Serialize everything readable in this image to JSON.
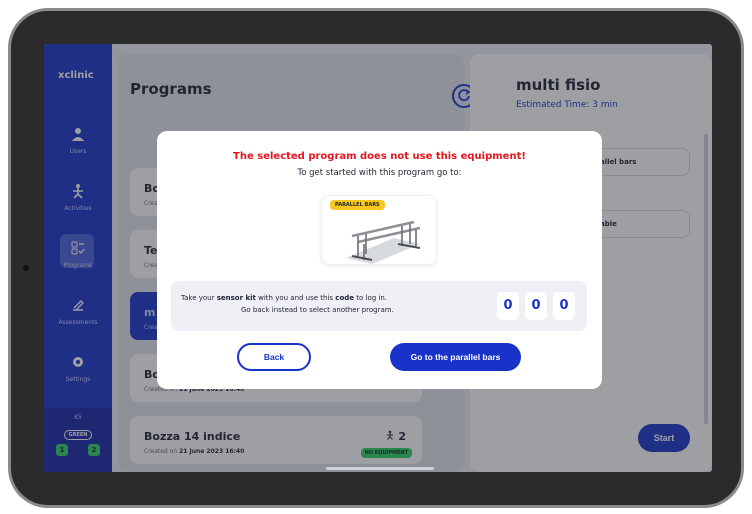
{
  "sidebar": {
    "brand": "xclinic",
    "items": [
      {
        "label": "Users",
        "icon": "user-icon"
      },
      {
        "label": "Activities",
        "icon": "activities-icon"
      },
      {
        "label": "Programs",
        "icon": "programs-icon"
      },
      {
        "label": "Assessments",
        "icon": "assessments-icon"
      },
      {
        "label": "Settings",
        "icon": "settings-icon"
      }
    ],
    "kit": {
      "id": "K5",
      "status": "GREEN",
      "left": "1",
      "right": "2"
    }
  },
  "programs": {
    "title": "Programs",
    "cards": [
      {
        "name": "Bo",
        "date_prefix": "Crea",
        "date": ""
      },
      {
        "name": "Te",
        "date_prefix": "Crea",
        "date": ""
      },
      {
        "name": "m",
        "date_prefix": "Crea",
        "date": ""
      },
      {
        "name": "Bo",
        "date_prefix": "Created on",
        "date": "21 June 2023 16:40"
      },
      {
        "name": "Bozza 14 indice",
        "date_prefix": "Created on",
        "date": "21 June 2023 16:40",
        "count": "2",
        "badge": "NO EQUIPMENT"
      }
    ]
  },
  "detail": {
    "title": "multi fisio",
    "estimated": "Estimated Time: 3 min",
    "equipment": [
      "allel bars",
      "able"
    ],
    "start": "Start"
  },
  "modal": {
    "title": "The selected program does not use this equipment!",
    "subtitle": "To get started with this program go to:",
    "equipment_tag": "PARALLEL BARS",
    "info": {
      "p1": "Take your ",
      "kit": "sensor kit",
      "p2": " with you and use this ",
      "code": "code",
      "p3": " to log in.",
      "line2": "Go back instead to select another program."
    },
    "digits": [
      "0",
      "0",
      "0"
    ],
    "back": "Back",
    "go": "Go to the parallel bars"
  },
  "colors": {
    "accent": "#1933c9",
    "warning": "#e0161e",
    "success": "#2ecf6b",
    "tag": "#f6c81f"
  }
}
